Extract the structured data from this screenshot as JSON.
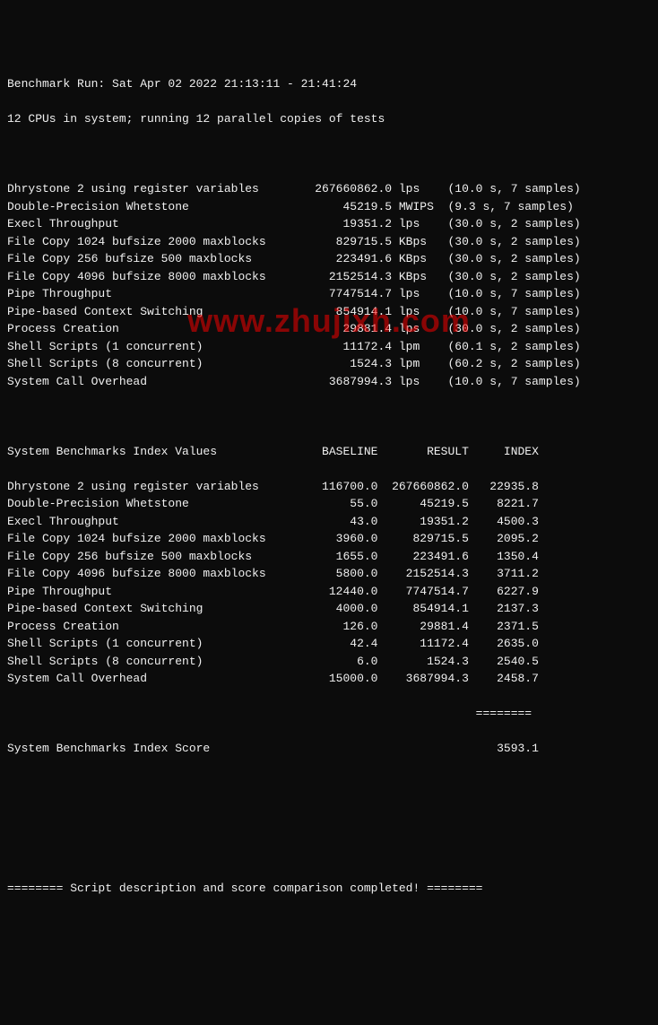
{
  "header": {
    "run_line": "Benchmark Run: Sat Apr 02 2022 21:13:11 - 21:41:24",
    "cpu_line": "12 CPUs in system; running 12 parallel copies of tests"
  },
  "results": [
    {
      "name": "Dhrystone 2 using register variables",
      "value": "267660862.0",
      "unit": "lps",
      "time": "10.0",
      "samples": "7"
    },
    {
      "name": "Double-Precision Whetstone",
      "value": "45219.5",
      "unit": "MWIPS",
      "time": "9.3",
      "samples": "7"
    },
    {
      "name": "Execl Throughput",
      "value": "19351.2",
      "unit": "lps",
      "time": "30.0",
      "samples": "2"
    },
    {
      "name": "File Copy 1024 bufsize 2000 maxblocks",
      "value": "829715.5",
      "unit": "KBps",
      "time": "30.0",
      "samples": "2"
    },
    {
      "name": "File Copy 256 bufsize 500 maxblocks",
      "value": "223491.6",
      "unit": "KBps",
      "time": "30.0",
      "samples": "2"
    },
    {
      "name": "File Copy 4096 bufsize 8000 maxblocks",
      "value": "2152514.3",
      "unit": "KBps",
      "time": "30.0",
      "samples": "2"
    },
    {
      "name": "Pipe Throughput",
      "value": "7747514.7",
      "unit": "lps",
      "time": "10.0",
      "samples": "7"
    },
    {
      "name": "Pipe-based Context Switching",
      "value": "854914.1",
      "unit": "lps",
      "time": "10.0",
      "samples": "7"
    },
    {
      "name": "Process Creation",
      "value": "29881.4",
      "unit": "lps",
      "time": "30.0",
      "samples": "2"
    },
    {
      "name": "Shell Scripts (1 concurrent)",
      "value": "11172.4",
      "unit": "lpm",
      "time": "60.1",
      "samples": "2"
    },
    {
      "name": "Shell Scripts (8 concurrent)",
      "value": "1524.3",
      "unit": "lpm",
      "time": "60.2",
      "samples": "2"
    },
    {
      "name": "System Call Overhead",
      "value": "3687994.3",
      "unit": "lps",
      "time": "10.0",
      "samples": "7"
    }
  ],
  "index_header": {
    "title": "System Benchmarks Index Values",
    "col_baseline": "BASELINE",
    "col_result": "RESULT",
    "col_index": "INDEX"
  },
  "index_rows": [
    {
      "name": "Dhrystone 2 using register variables",
      "baseline": "116700.0",
      "result": "267660862.0",
      "index": "22935.8"
    },
    {
      "name": "Double-Precision Whetstone",
      "baseline": "55.0",
      "result": "45219.5",
      "index": "8221.7"
    },
    {
      "name": "Execl Throughput",
      "baseline": "43.0",
      "result": "19351.2",
      "index": "4500.3"
    },
    {
      "name": "File Copy 1024 bufsize 2000 maxblocks",
      "baseline": "3960.0",
      "result": "829715.5",
      "index": "2095.2"
    },
    {
      "name": "File Copy 256 bufsize 500 maxblocks",
      "baseline": "1655.0",
      "result": "223491.6",
      "index": "1350.4"
    },
    {
      "name": "File Copy 4096 bufsize 8000 maxblocks",
      "baseline": "5800.0",
      "result": "2152514.3",
      "index": "3711.2"
    },
    {
      "name": "Pipe Throughput",
      "baseline": "12440.0",
      "result": "7747514.7",
      "index": "6227.9"
    },
    {
      "name": "Pipe-based Context Switching",
      "baseline": "4000.0",
      "result": "854914.1",
      "index": "2137.3"
    },
    {
      "name": "Process Creation",
      "baseline": "126.0",
      "result": "29881.4",
      "index": "2371.5"
    },
    {
      "name": "Shell Scripts (1 concurrent)",
      "baseline": "42.4",
      "result": "11172.4",
      "index": "2635.0"
    },
    {
      "name": "Shell Scripts (8 concurrent)",
      "baseline": "6.0",
      "result": "1524.3",
      "index": "2540.5"
    },
    {
      "name": "System Call Overhead",
      "baseline": "15000.0",
      "result": "3687994.3",
      "index": "2458.7"
    }
  ],
  "score": {
    "divider": "                                                                   ========",
    "label": "System Benchmarks Index Score",
    "value": "3593.1"
  },
  "footer": {
    "line": "======== Script description and score comparison completed! ========"
  },
  "watermark": "www.zhujixh.com"
}
